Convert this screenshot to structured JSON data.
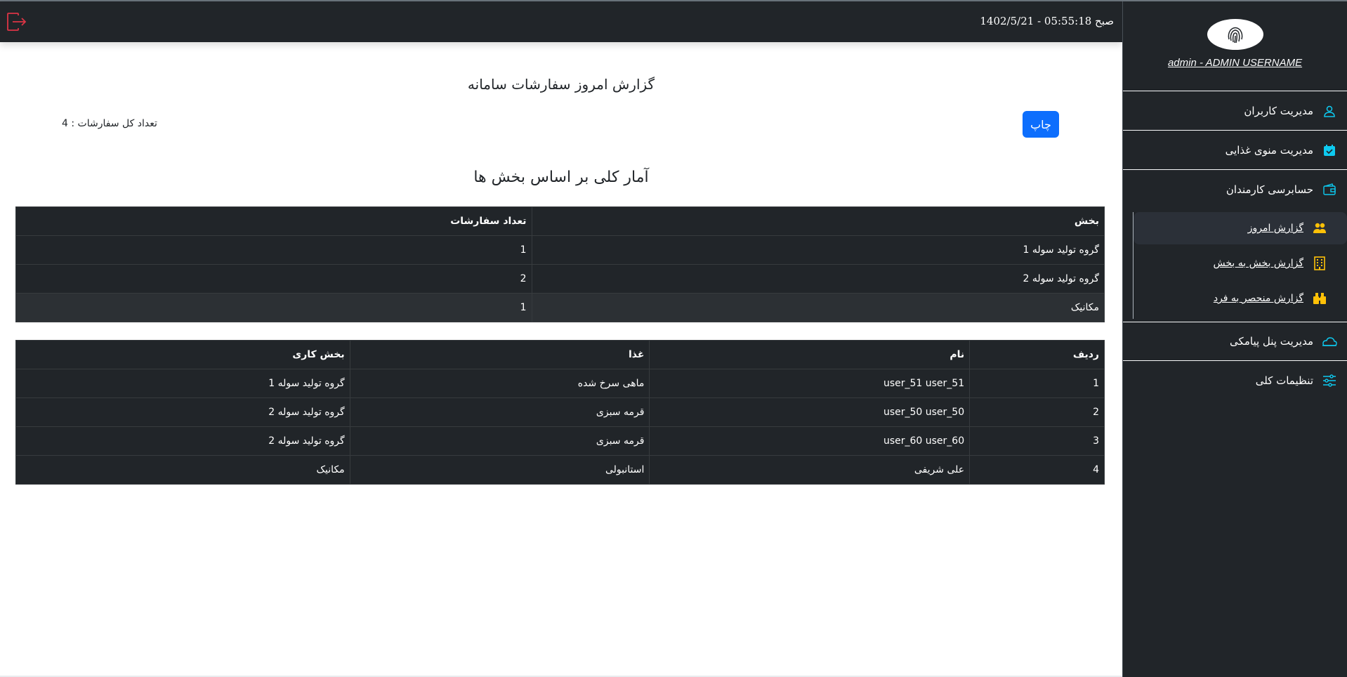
{
  "topbar": {
    "datetime": "صبح 05:55:18 - 1402/5/21",
    "logout_icon": "logout-icon",
    "logout_color": "#dc3545"
  },
  "sidebar": {
    "username": "admin - ADMIN USERNAME",
    "logo_icon": "fingerprint-icon",
    "items": [
      {
        "label": "مدیریت کاربران",
        "icon": "user-icon"
      },
      {
        "label": "مدیریت منوی غذایی",
        "icon": "calendar-check-icon"
      },
      {
        "label": "حسابرسی کارمندان",
        "icon": "wallet-icon"
      }
    ],
    "subitems": [
      {
        "label": "گزارش امروز",
        "icon": "users-icon"
      },
      {
        "label": "گزارش بخش به بخش",
        "icon": "building-icon"
      },
      {
        "label": "گزارش منحصر به فرد",
        "icon": "binoculars-icon"
      }
    ],
    "bottom_items": [
      {
        "label": "مدیریت پنل پیامکی",
        "icon": "cloud-icon"
      },
      {
        "label": "تنظیمات کلی",
        "icon": "sliders-icon"
      }
    ],
    "accent_color": "#0dcaf0",
    "sub_icon_color": "#ffc107"
  },
  "main": {
    "title": "گزارش امروز سفارشات سامانه",
    "print_label": "چاپ",
    "total_orders": "تعداد کل سفارشات : 4",
    "section_title": "آمار کلی بر اساس بخش ها"
  },
  "dept_table": {
    "headers": [
      "بخش",
      "تعداد سفارشات"
    ],
    "rows": [
      [
        "گروه تولید سوله 1",
        "1"
      ],
      [
        "گروه تولید سوله 2",
        "2"
      ],
      [
        "مکانیک",
        "1"
      ]
    ]
  },
  "orders_table": {
    "headers": [
      "ردیف",
      "نام",
      "غذا",
      "بخش کاری"
    ],
    "rows": [
      [
        "1",
        "user_51 user_51",
        "ماهی سرخ شده",
        "گروه تولید سوله 1"
      ],
      [
        "2",
        "user_50 user_50",
        "قرمه سبزی",
        "گروه تولید سوله 2"
      ],
      [
        "3",
        "user_60 user_60",
        "قرمه سبزی",
        "گروه تولید سوله 2"
      ],
      [
        "4",
        "علی شریفی",
        "استانبولی",
        "مکانیک"
      ]
    ]
  }
}
